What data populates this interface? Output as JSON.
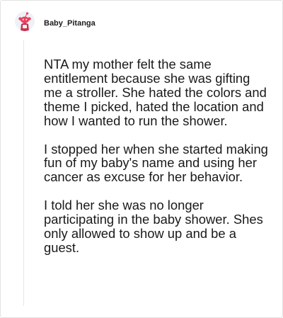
{
  "comment": {
    "username": "Baby_Pitanga",
    "avatar_icon": "snoo-avatar-icon",
    "accent_color": "#e8415f",
    "paragraphs": [
      "NTA my mother felt the same entitlement because she was gifting me a stroller. She hated the colors and theme I picked, hated the location and how I wanted to run the shower.",
      "I stopped her when she started making fun of my baby's name and using her cancer as excuse for her behavior.",
      "I told her she was no longer participating in the baby shower. Shes only allowed to show up and be a guest."
    ]
  }
}
